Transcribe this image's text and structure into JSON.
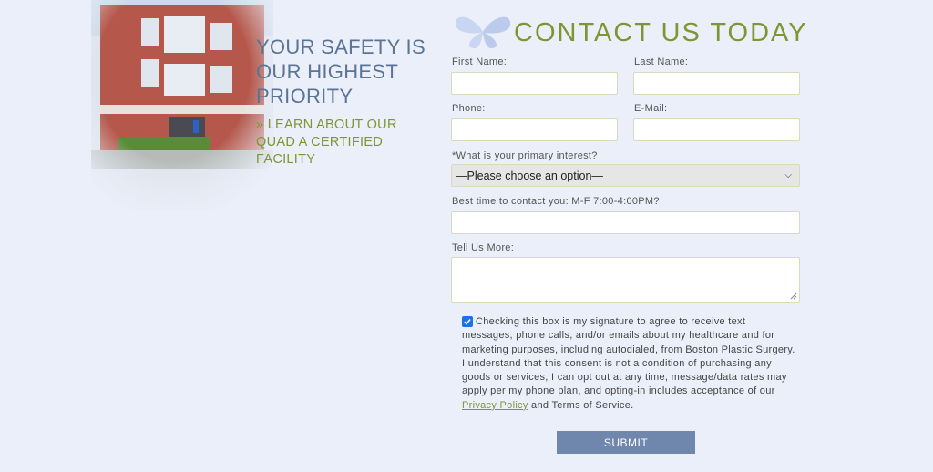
{
  "hero": {
    "tagline": "YOUR SAFETY IS OUR HIGHEST PRIORITY",
    "link": "» LEARN ABOUT OUR QUAD A CERTIFIED FACILITY"
  },
  "form": {
    "title": "CONTACT US TODAY",
    "first_name_label": "First Name:",
    "last_name_label": "Last Name:",
    "phone_label": "Phone:",
    "email_label": "E-Mail:",
    "interest_label": "*What is your primary interest?",
    "interest_value": "—Please choose an option—",
    "best_time_label": "Best time to contact you: M-F 7:00-4:00PM?",
    "more_label": "Tell Us More:",
    "consent_before": "Checking this box is my signature to agree to receive text messages, phone calls, and/or emails about my healthcare and for marketing purposes, including autodialed, from Boston Plastic Surgery. I understand that this consent is not a condition of purchasing any goods or services, I can opt out at any time, message/data rates may apply per my phone plan, and opting-in includes acceptance of our ",
    "privacy_link": "Privacy Policy",
    "consent_after": " and Terms of Service.",
    "consent_checked": true,
    "submit_label": "SUBMIT"
  },
  "colors": {
    "accent_green": "#7c9632",
    "heading_blue": "#5a7497",
    "button_blue": "#6f86ad",
    "background": "#eaeff9"
  }
}
